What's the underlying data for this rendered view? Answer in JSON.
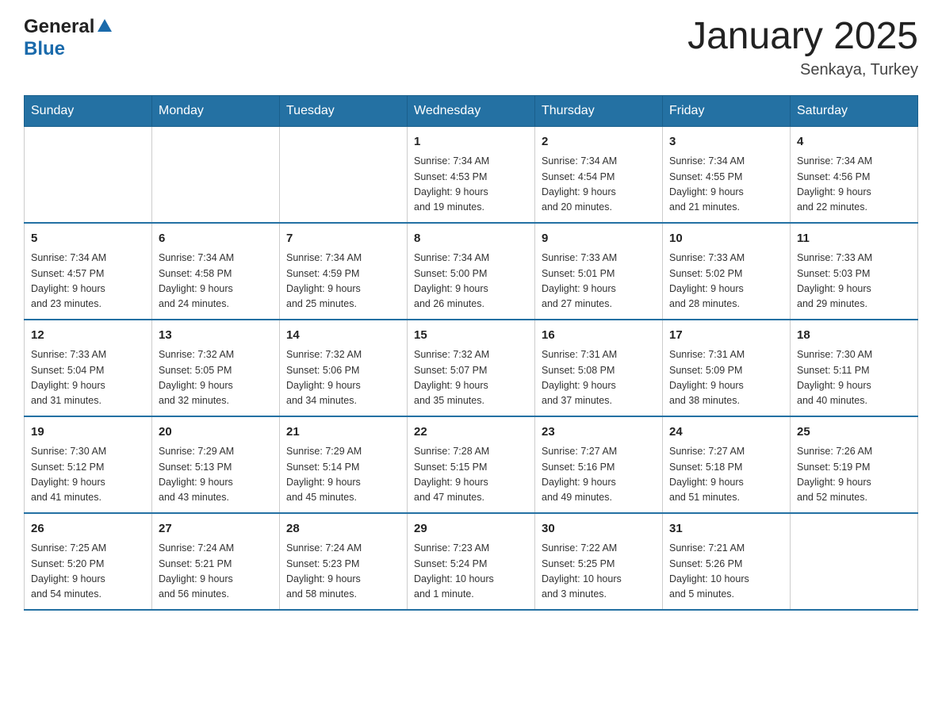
{
  "header": {
    "logo": {
      "general": "General",
      "arrow": "▲",
      "blue": "Blue"
    },
    "title": "January 2025",
    "subtitle": "Senkaya, Turkey"
  },
  "days_of_week": [
    "Sunday",
    "Monday",
    "Tuesday",
    "Wednesday",
    "Thursday",
    "Friday",
    "Saturday"
  ],
  "weeks": [
    {
      "days": [
        {
          "number": "",
          "info": ""
        },
        {
          "number": "",
          "info": ""
        },
        {
          "number": "",
          "info": ""
        },
        {
          "number": "1",
          "info": "Sunrise: 7:34 AM\nSunset: 4:53 PM\nDaylight: 9 hours\nand 19 minutes."
        },
        {
          "number": "2",
          "info": "Sunrise: 7:34 AM\nSunset: 4:54 PM\nDaylight: 9 hours\nand 20 minutes."
        },
        {
          "number": "3",
          "info": "Sunrise: 7:34 AM\nSunset: 4:55 PM\nDaylight: 9 hours\nand 21 minutes."
        },
        {
          "number": "4",
          "info": "Sunrise: 7:34 AM\nSunset: 4:56 PM\nDaylight: 9 hours\nand 22 minutes."
        }
      ]
    },
    {
      "days": [
        {
          "number": "5",
          "info": "Sunrise: 7:34 AM\nSunset: 4:57 PM\nDaylight: 9 hours\nand 23 minutes."
        },
        {
          "number": "6",
          "info": "Sunrise: 7:34 AM\nSunset: 4:58 PM\nDaylight: 9 hours\nand 24 minutes."
        },
        {
          "number": "7",
          "info": "Sunrise: 7:34 AM\nSunset: 4:59 PM\nDaylight: 9 hours\nand 25 minutes."
        },
        {
          "number": "8",
          "info": "Sunrise: 7:34 AM\nSunset: 5:00 PM\nDaylight: 9 hours\nand 26 minutes."
        },
        {
          "number": "9",
          "info": "Sunrise: 7:33 AM\nSunset: 5:01 PM\nDaylight: 9 hours\nand 27 minutes."
        },
        {
          "number": "10",
          "info": "Sunrise: 7:33 AM\nSunset: 5:02 PM\nDaylight: 9 hours\nand 28 minutes."
        },
        {
          "number": "11",
          "info": "Sunrise: 7:33 AM\nSunset: 5:03 PM\nDaylight: 9 hours\nand 29 minutes."
        }
      ]
    },
    {
      "days": [
        {
          "number": "12",
          "info": "Sunrise: 7:33 AM\nSunset: 5:04 PM\nDaylight: 9 hours\nand 31 minutes."
        },
        {
          "number": "13",
          "info": "Sunrise: 7:32 AM\nSunset: 5:05 PM\nDaylight: 9 hours\nand 32 minutes."
        },
        {
          "number": "14",
          "info": "Sunrise: 7:32 AM\nSunset: 5:06 PM\nDaylight: 9 hours\nand 34 minutes."
        },
        {
          "number": "15",
          "info": "Sunrise: 7:32 AM\nSunset: 5:07 PM\nDaylight: 9 hours\nand 35 minutes."
        },
        {
          "number": "16",
          "info": "Sunrise: 7:31 AM\nSunset: 5:08 PM\nDaylight: 9 hours\nand 37 minutes."
        },
        {
          "number": "17",
          "info": "Sunrise: 7:31 AM\nSunset: 5:09 PM\nDaylight: 9 hours\nand 38 minutes."
        },
        {
          "number": "18",
          "info": "Sunrise: 7:30 AM\nSunset: 5:11 PM\nDaylight: 9 hours\nand 40 minutes."
        }
      ]
    },
    {
      "days": [
        {
          "number": "19",
          "info": "Sunrise: 7:30 AM\nSunset: 5:12 PM\nDaylight: 9 hours\nand 41 minutes."
        },
        {
          "number": "20",
          "info": "Sunrise: 7:29 AM\nSunset: 5:13 PM\nDaylight: 9 hours\nand 43 minutes."
        },
        {
          "number": "21",
          "info": "Sunrise: 7:29 AM\nSunset: 5:14 PM\nDaylight: 9 hours\nand 45 minutes."
        },
        {
          "number": "22",
          "info": "Sunrise: 7:28 AM\nSunset: 5:15 PM\nDaylight: 9 hours\nand 47 minutes."
        },
        {
          "number": "23",
          "info": "Sunrise: 7:27 AM\nSunset: 5:16 PM\nDaylight: 9 hours\nand 49 minutes."
        },
        {
          "number": "24",
          "info": "Sunrise: 7:27 AM\nSunset: 5:18 PM\nDaylight: 9 hours\nand 51 minutes."
        },
        {
          "number": "25",
          "info": "Sunrise: 7:26 AM\nSunset: 5:19 PM\nDaylight: 9 hours\nand 52 minutes."
        }
      ]
    },
    {
      "days": [
        {
          "number": "26",
          "info": "Sunrise: 7:25 AM\nSunset: 5:20 PM\nDaylight: 9 hours\nand 54 minutes."
        },
        {
          "number": "27",
          "info": "Sunrise: 7:24 AM\nSunset: 5:21 PM\nDaylight: 9 hours\nand 56 minutes."
        },
        {
          "number": "28",
          "info": "Sunrise: 7:24 AM\nSunset: 5:23 PM\nDaylight: 9 hours\nand 58 minutes."
        },
        {
          "number": "29",
          "info": "Sunrise: 7:23 AM\nSunset: 5:24 PM\nDaylight: 10 hours\nand 1 minute."
        },
        {
          "number": "30",
          "info": "Sunrise: 7:22 AM\nSunset: 5:25 PM\nDaylight: 10 hours\nand 3 minutes."
        },
        {
          "number": "31",
          "info": "Sunrise: 7:21 AM\nSunset: 5:26 PM\nDaylight: 10 hours\nand 5 minutes."
        },
        {
          "number": "",
          "info": ""
        }
      ]
    }
  ]
}
